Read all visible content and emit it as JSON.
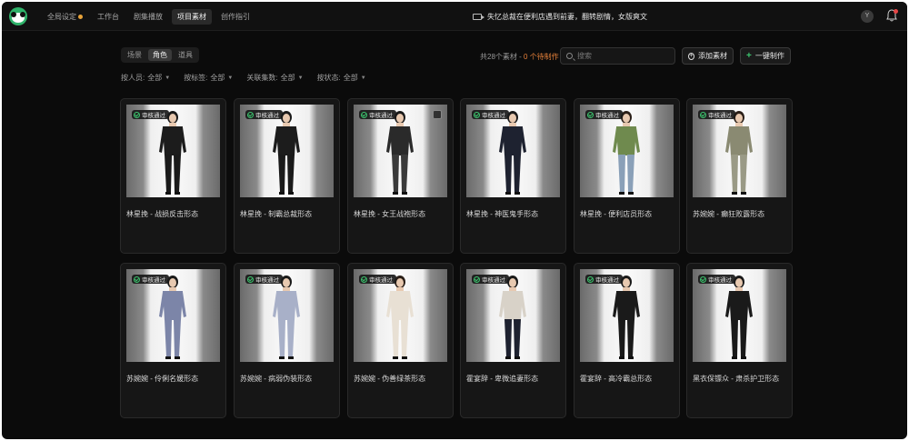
{
  "nav": {
    "items": [
      {
        "label": "全局设定"
      },
      {
        "label": "工作台"
      },
      {
        "label": "剧集播放"
      },
      {
        "label": "项目素材"
      },
      {
        "label": "创作指引"
      }
    ],
    "active_index": 3,
    "episode_title": "失忆总裁在便利店遇到前妻，翻转剧情，女版爽文",
    "avatar_initial": "Y"
  },
  "toolbar": {
    "tabs": [
      {
        "label": "场景"
      },
      {
        "label": "角色"
      },
      {
        "label": "道具"
      }
    ],
    "active_tab": 1,
    "count_prefix": "共28个素材 - ",
    "count_pending": "0 个待制作",
    "search_placeholder": "搜索",
    "add_label": "添加素材",
    "make_label": "一键制作"
  },
  "filters": [
    {
      "label": "按人员:",
      "value": "全部"
    },
    {
      "label": "按标签:",
      "value": "全部"
    },
    {
      "label": "关联集数:",
      "value": "全部"
    },
    {
      "label": "按状态:",
      "value": "全部"
    }
  ],
  "badge_label": "审核通过",
  "cards": [
    {
      "title": "林星挽 - 战损反击形态",
      "outfit": "#1c1c1c",
      "pants": "#1a1a1a",
      "hair": "#1a1a1a"
    },
    {
      "title": "林星挽 - 制霸总裁形态",
      "outfit": "#1c1c1c",
      "pants": "#1a1a1a",
      "hair": "#1a1a1a"
    },
    {
      "title": "林星挽 - 女王战袍形态",
      "outfit": "#2a2a2a",
      "pants": "#3a3a3a",
      "hair": "#1a1a1a"
    },
    {
      "title": "林星挽 - 神医鬼手形态",
      "outfit": "#1e2230",
      "pants": "#1e2230",
      "hair": "#1a1a1a"
    },
    {
      "title": "林星挽 - 便利店员形态",
      "outfit": "#6f8a4e",
      "pants": "#8aa0b8",
      "hair": "#2a1f18"
    },
    {
      "title": "苏婉婉 - 癫狂败露形态",
      "outfit": "#8a8a72",
      "pants": "#9a9a86",
      "hair": "#2a1f18"
    },
    {
      "title": "苏婉婉 - 伶俐名媛形态",
      "outfit": "#7c85a8",
      "pants": "#7c85a8",
      "hair": "#1a1a1a"
    },
    {
      "title": "苏婉婉 - 病弱伪装形态",
      "outfit": "#a8b0c8",
      "pants": "#a8b0c8",
      "hair": "#1a1a1a"
    },
    {
      "title": "苏婉婉 - 伪善绿茶形态",
      "outfit": "#e8e0d4",
      "pants": "#e8e0d4",
      "hair": "#2a1f18"
    },
    {
      "title": "霍宴辞 - 卑微追妻形态",
      "outfit": "#d8d2c8",
      "pants": "#1e2230",
      "hair": "#1a1a1a"
    },
    {
      "title": "霍宴辞 - 高冷霸总形态",
      "outfit": "#1a1a1a",
      "pants": "#1a1a1a",
      "hair": "#1a1a1a"
    },
    {
      "title": "黑衣保镖众 - 肃杀护卫形态",
      "outfit": "#1a1a1a",
      "pants": "#1a1a1a",
      "hair": "#1a1a1a"
    }
  ]
}
